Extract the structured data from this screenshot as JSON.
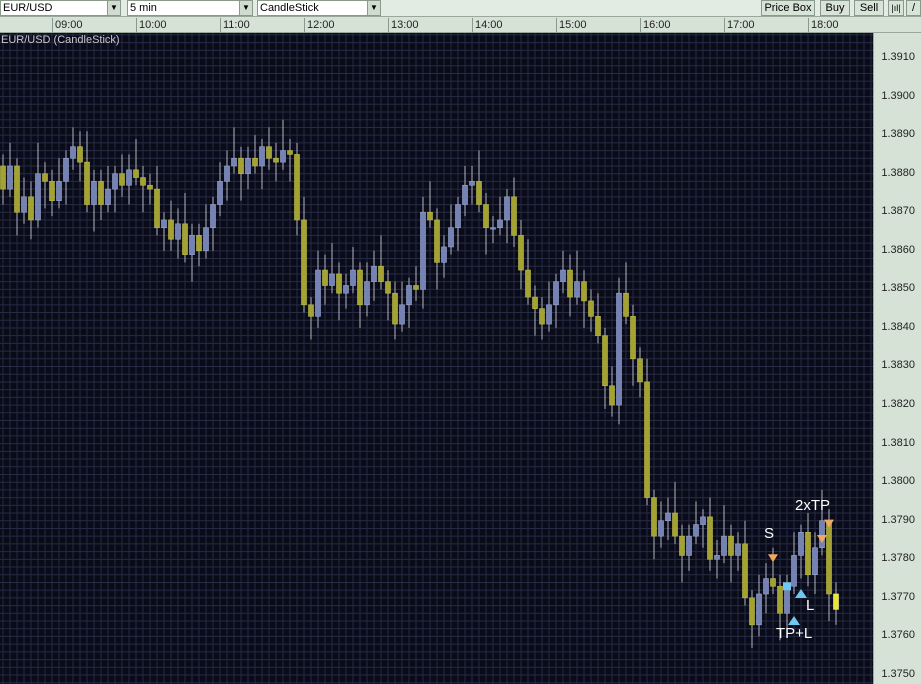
{
  "toolbar": {
    "symbol": "EUR/USD",
    "interval": "5 min",
    "chart_type": "CandleStick",
    "price_box": "Price Box",
    "buy": "Buy",
    "sell": "Sell",
    "icons": [
      "bars-icon",
      "draw-line-icon"
    ]
  },
  "colors": {
    "bull": "#7482b4",
    "bear": "#a3a232",
    "wick": "#b4b4c4",
    "current": "#e6e63c",
    "grid": "#262a44",
    "sell_marker": "#f0a860",
    "buy_marker": "#70c8f0"
  },
  "chart_data": {
    "type": "candlestick",
    "title": "EUR/USD (CandleStick)",
    "x_ticks": [
      "09:00",
      "10:00",
      "11:00",
      "12:00",
      "13:00",
      "14:00",
      "15:00",
      "16:00",
      "17:00",
      "18:00"
    ],
    "y_ticks": [
      "1.3910",
      "1.3900",
      "1.3890",
      "1.3880",
      "1.3870",
      "1.3860",
      "1.3850",
      "1.3840",
      "1.3830",
      "1.3820",
      "1.3810",
      "1.3800",
      "1.3790",
      "1.3780",
      "1.3770",
      "1.3760",
      "1.3750"
    ],
    "ylim": [
      1.375,
      1.391
    ],
    "interval_minutes": 5,
    "first_open": 1.3882,
    "close": [
      1.3876,
      1.3882,
      1.387,
      1.3874,
      1.3868,
      1.388,
      1.3878,
      1.3873,
      1.3878,
      1.3884,
      1.3887,
      1.3883,
      1.3872,
      1.3878,
      1.3872,
      1.3876,
      1.388,
      1.3877,
      1.3881,
      1.3879,
      1.3877,
      1.3876,
      1.3866,
      1.3868,
      1.3863,
      1.3867,
      1.3859,
      1.3864,
      1.386,
      1.3866,
      1.3872,
      1.3878,
      1.3882,
      1.3884,
      1.388,
      1.3884,
      1.3882,
      1.3887,
      1.3884,
      1.3883,
      1.3886,
      1.3885,
      1.3868,
      1.3846,
      1.3843,
      1.3855,
      1.3851,
      1.3854,
      1.3849,
      1.3851,
      1.3855,
      1.3846,
      1.3852,
      1.3856,
      1.3852,
      1.3849,
      1.3841,
      1.3846,
      1.3851,
      1.385,
      1.387,
      1.3868,
      1.3857,
      1.3861,
      1.3866,
      1.3872,
      1.3877,
      1.3878,
      1.3872,
      1.3866,
      1.3866,
      1.3868,
      1.3874,
      1.3864,
      1.3855,
      1.3848,
      1.3845,
      1.3841,
      1.3846,
      1.3852,
      1.3855,
      1.3848,
      1.3852,
      1.3847,
      1.3843,
      1.3838,
      1.3825,
      1.382,
      1.3849,
      1.3843,
      1.3832,
      1.3826,
      1.3796,
      1.3786,
      1.379,
      1.3792,
      1.3786,
      1.3781,
      1.3786,
      1.3789,
      1.3791,
      1.378,
      1.3781,
      1.3786,
      1.3781,
      1.3784,
      1.377,
      1.3763,
      1.3771,
      1.3775,
      1.3773,
      1.3766,
      1.3773,
      1.3781,
      1.3787,
      1.3776,
      1.3783,
      1.379,
      1.3771,
      1.3767
    ],
    "wick_high_pips_pattern": [
      3,
      6,
      2,
      5,
      4,
      8,
      3
    ],
    "wick_low_pips_pattern": [
      4,
      2,
      6,
      3,
      5,
      2,
      7
    ],
    "markers": [
      {
        "label": "S",
        "type": "sell",
        "price": 1.378,
        "bar": 110
      },
      {
        "label": "",
        "type": "square",
        "price": 1.3773,
        "bar": 112
      },
      {
        "label": "L",
        "type": "buy",
        "price": 1.3771,
        "bar": 114
      },
      {
        "label": "TP+L",
        "type": "buy",
        "price": 1.3764,
        "bar": 113
      },
      {
        "label": "",
        "type": "sell",
        "price": 1.3785,
        "bar": 117
      },
      {
        "label": "2xTP",
        "type": "sell",
        "price": 1.3789,
        "bar": 118
      }
    ]
  }
}
